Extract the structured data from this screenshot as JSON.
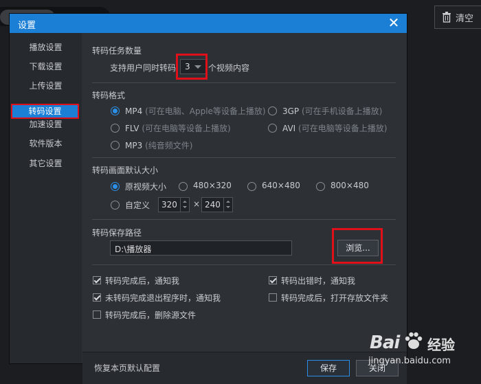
{
  "background": {
    "clear_label": "清空"
  },
  "dialog": {
    "title": "设置",
    "close_glyph": "✕",
    "accent_color": "#1b7fd6",
    "highlight_color": "#e0101a"
  },
  "sidebar": {
    "items": [
      {
        "label": "播放设置"
      },
      {
        "label": "下载设置"
      },
      {
        "label": "上传设置"
      },
      {
        "label": "转码设置",
        "active": true
      },
      {
        "label": "加速设置"
      },
      {
        "label": "软件版本"
      },
      {
        "label": "其它设置"
      }
    ]
  },
  "tasks": {
    "title": "转码任务数量",
    "prefix": "支持用户同时转码",
    "value": "3",
    "suffix": "个视频内容"
  },
  "format": {
    "title": "转码格式",
    "options": [
      {
        "name": "MP4",
        "hint": "(可在电脑、Apple等设备上播放)",
        "selected": true
      },
      {
        "name": "3GP",
        "hint": "(可在手机设备上播放)",
        "selected": false
      },
      {
        "name": "FLV",
        "hint": "(可在电脑等设备上播放)",
        "selected": false
      },
      {
        "name": "AVI",
        "hint": "(可在电脑等设备上播放)",
        "selected": false
      },
      {
        "name": "MP3",
        "hint": "(纯音频文件)",
        "selected": false
      }
    ]
  },
  "size": {
    "title": "转码画面默认大小",
    "options": [
      {
        "label": "原视频大小",
        "selected": true
      },
      {
        "label": "480×320",
        "selected": false
      },
      {
        "label": "640×480",
        "selected": false
      },
      {
        "label": "800×480",
        "selected": false
      }
    ],
    "custom_label": "自定义",
    "custom_width": "320",
    "times": "×",
    "custom_height": "240"
  },
  "path": {
    "title": "转码保存路径",
    "value": "D:\\播放器",
    "browse_label": "浏览..."
  },
  "checks": [
    {
      "label": "转码完成后，通知我",
      "checked": true
    },
    {
      "label": "转码出错时，通知我",
      "checked": true
    },
    {
      "label": "未转码完成退出程序时，通知我",
      "checked": true
    },
    {
      "label": "转码完成后，打开存放文件夹",
      "checked": false
    },
    {
      "label": "转码完成后，删除源文件",
      "checked": false
    }
  ],
  "footer": {
    "restore_label": "恢复本页默认配置",
    "save_label": "保存",
    "cancel_label": "关闭"
  },
  "watermark": {
    "logo": "Bai",
    "logo_suffix": "经验",
    "url": "jingyan.baidu.com"
  }
}
